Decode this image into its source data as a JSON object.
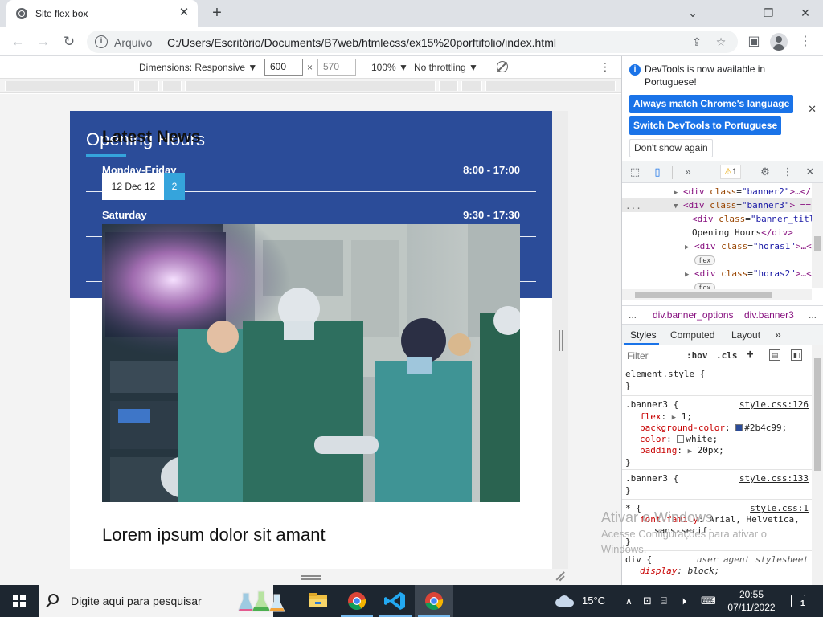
{
  "browser": {
    "tab_title": "Site flex box",
    "url_scheme": "Arquivo",
    "url": "C:/Users/Escritório/Documents/B7web/htmlecss/ex15%20porftifolio/index.html"
  },
  "device_toolbar": {
    "dimensions_label": "Dimensions: Responsive",
    "width": "600",
    "height": "570",
    "zoom": "100%",
    "throttling": "No throttling",
    "dropdown_glyph": "▼",
    "times_glyph": "×"
  },
  "page": {
    "banner": {
      "title": "Opening Hours",
      "background": "#2b4c99",
      "rows": [
        {
          "day": "Monday-Friday",
          "hours": "8:00 - 17:00"
        },
        {
          "day": "Saturday",
          "hours": "9:30 - 17:30"
        }
      ]
    },
    "news": {
      "title": "Latest News",
      "date": "12 Dec 12",
      "count": "2",
      "heading": "Lorem ipsum dolor sit amant"
    }
  },
  "watermark": {
    "title": "Ativar o Windows",
    "line1": "Acesse Configurações para ativar o",
    "line2": "Windows."
  },
  "devtools": {
    "notice": "DevTools is now available in Portuguese!",
    "btn_match": "Always match Chrome's language",
    "btn_switch": "Switch DevTools to Portuguese",
    "btn_dont": "Don't show again",
    "warning_count": "1",
    "dom": {
      "line1": {
        "tag_open": "<div ",
        "attr": "class",
        "val": "\"banner2\"",
        "rest": ">…</"
      },
      "line2": {
        "tag_open": "<div ",
        "attr": "class",
        "val": "\"banner3\"",
        "rest": "> =="
      },
      "line3": {
        "tag_open": "<div ",
        "attr": "class",
        "val": "\"banner_titl"
      },
      "line4": {
        "text": "Opening Hours",
        "close": "</div>"
      },
      "line5": {
        "tag_open": "<div ",
        "attr": "class",
        "val": "\"horas1\"",
        "rest": ">…<"
      },
      "line6": {
        "tag_open": "<div ",
        "attr": "class",
        "val": "\"horas2\"",
        "rest": ">…<"
      },
      "flex_badge": "flex",
      "ellipsis": "..."
    },
    "breadcrumbs": [
      "div.banner_options",
      "div.banner3"
    ],
    "styles_tabs": [
      "Styles",
      "Computed",
      "Layout"
    ],
    "filter_placeholder": "Filter",
    "filter_hov": ":hov",
    "filter_cls": ".cls",
    "rules": {
      "element_style": "element.style {",
      "close": "}",
      "banner3_selector": ".banner3 {",
      "banner3_src": "style.css:126",
      "flex_prop": "flex",
      "flex_val": "1;",
      "bg_prop": "background-color",
      "bg_val": "#2b4c99;",
      "color_prop": "color",
      "color_val": "white;",
      "padding_prop": "padding",
      "padding_val": "20px;",
      "banner3b_src": "style.css:133",
      "star_selector": "* {",
      "star_src": "style.css:1",
      "font_prop": "font-family",
      "font_val": "Arial, Helvetica,",
      "font_val2": "sans-serif;",
      "div_selector": "div {",
      "div_src": "user agent stylesheet",
      "display_prop": "display",
      "display_val": "block;"
    }
  },
  "taskbar": {
    "search_placeholder": "Digite aqui para pesquisar",
    "temperature": "15°C",
    "time": "20:55",
    "date": "07/11/2022",
    "notifications": "1"
  },
  "colors": {
    "banner_blue": "#2b4c99",
    "accent_cyan": "#35a4dc",
    "chrome_blue": "#1a73e8"
  }
}
